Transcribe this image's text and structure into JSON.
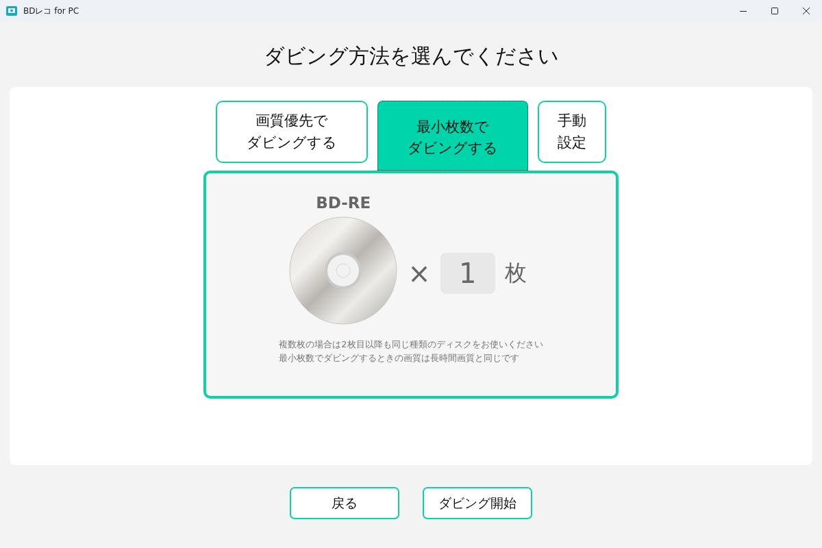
{
  "window": {
    "title": "BDレコ for PC"
  },
  "heading": "ダビング方法を選んでください",
  "tabs": [
    {
      "lines": [
        "画質優先で",
        "ダビングする"
      ],
      "selected": false
    },
    {
      "lines": [
        "最小枚数で",
        "ダビングする"
      ],
      "selected": true
    },
    {
      "lines": [
        "手動",
        "設定"
      ],
      "selected": false
    }
  ],
  "disc": {
    "type": "BD-RE",
    "times": "×",
    "count": "1",
    "unit": "枚"
  },
  "notes": [
    "複数枚の場合は2枚目以降も同じ種類のディスクをお使いください",
    "最小枚数でダビングするときの画質は長時間画質と同じです"
  ],
  "buttons": [
    "戻る",
    "ダビング開始"
  ]
}
